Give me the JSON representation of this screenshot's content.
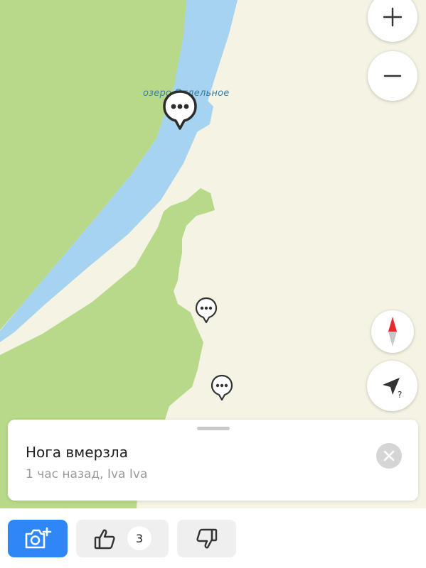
{
  "map": {
    "label": "озеро Отдельное",
    "colors": {
      "land": "#f5f3e4",
      "forest": "#b8d98a",
      "water": "#a6d3ef"
    }
  },
  "controls": {
    "zoom_in_icon": "plus-icon",
    "zoom_out_icon": "minus-icon",
    "compass_icon": "compass-icon",
    "location_icon": "location-arrow-unknown-icon"
  },
  "markers": [
    {
      "icon": "comment-bubble-icon",
      "selected": true
    },
    {
      "icon": "comment-bubble-icon",
      "selected": false
    },
    {
      "icon": "comment-bubble-icon",
      "selected": false
    }
  ],
  "sheet": {
    "title": "Нога вмерзла",
    "meta": "1 час назад, Iva Iva",
    "close_icon": "close-icon"
  },
  "actions": {
    "add_photo_icon": "camera-plus-icon",
    "like_icon": "thumbs-up-icon",
    "like_count": "3",
    "dislike_icon": "thumbs-down-icon",
    "accent": "#2f86f6"
  }
}
